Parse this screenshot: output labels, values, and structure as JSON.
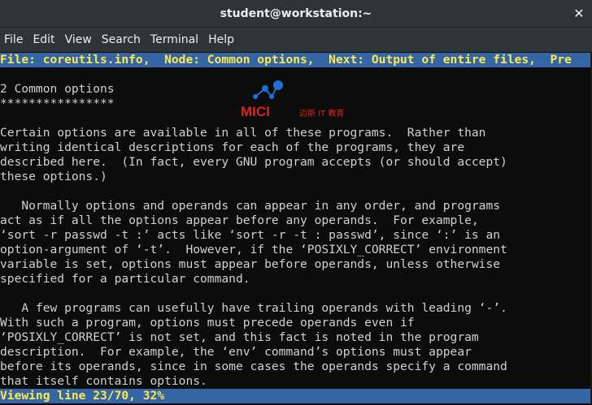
{
  "window": {
    "title": "student@workstation:~",
    "close_glyph": "✕"
  },
  "menu": {
    "items": [
      "File",
      "Edit",
      "View",
      "Search",
      "Terminal",
      "Help"
    ]
  },
  "info_header": "File: coreutils.info,  Node: Common options,  Next: Output of entire files,  Pre",
  "body_lines": [
    "",
    "2 Common options",
    "****************",
    "",
    "Certain options are available in all of these programs.  Rather than",
    "writing identical descriptions for each of the programs, they are",
    "described here.  (In fact, every GNU program accepts (or should accept)",
    "these options.)",
    "",
    "   Normally options and operands can appear in any order, and programs",
    "act as if all the options appear before any operands.  For example,",
    "‘sort -r passwd -t :’ acts like ‘sort -r -t : passwd’, since ‘:’ is an",
    "option-argument of ‘-t’.  However, if the ‘POSIXLY_CORRECT’ environment",
    "variable is set, options must appear before operands, unless otherwise",
    "specified for a particular command.",
    "",
    "   A few programs can usefully have trailing operands with leading ‘-’.",
    "With such a program, options must precede operands even if",
    "‘POSIXLY_CORRECT’ is not set, and this fact is noted in the program",
    "description.  For example, the ‘env’ command’s options must appear",
    "before its operands, since in some cases the operands specify a command",
    "that itself contains options."
  ],
  "status_line": "Viewing line 23/70, 32%",
  "watermark": {
    "brand": "MICI",
    "tagline": "迈斯 IT 教育",
    "colors": {
      "red": "#d9261c",
      "blue": "#1e6fd9"
    }
  },
  "colors": {
    "bar_bg": "#3465a4",
    "bar_fg": "#fce94f",
    "text": "#d0d0d0",
    "terminal_bg": "#0c0c0c",
    "chrome_bg": "#2f3436"
  }
}
